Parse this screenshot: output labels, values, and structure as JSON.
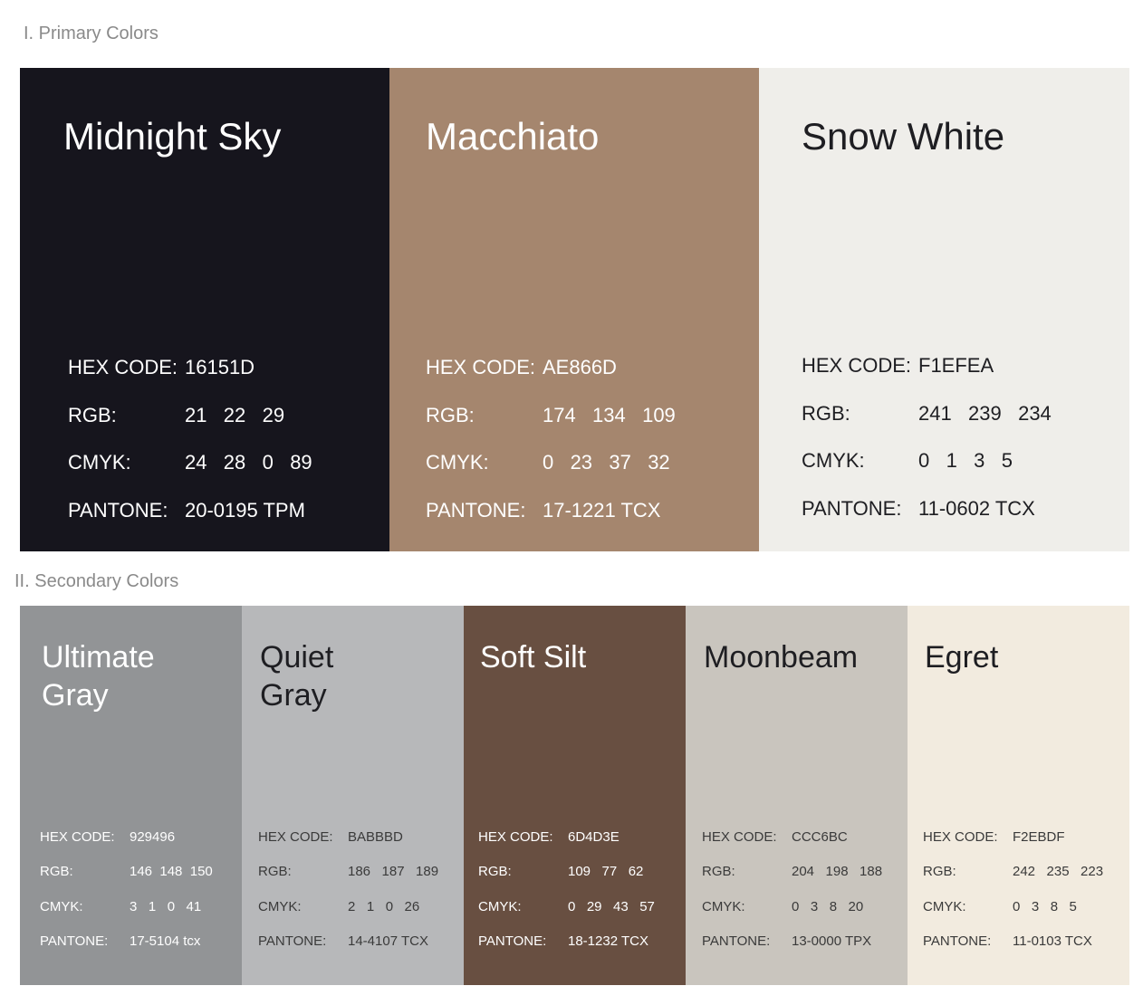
{
  "sections": {
    "primary_title": "I. Primary Colors",
    "secondary_title": "II. Secondary Colors"
  },
  "labels": {
    "hex": "HEX CODE:",
    "rgb": "RGB:",
    "cmyk": "CMYK:",
    "pantone": "PANTONE:"
  },
  "primary": [
    {
      "name": "Midnight Sky",
      "hex": "16151D",
      "rgb": "21   22   29",
      "cmyk": "24   28   0   89",
      "pantone": "20-0195 TPM",
      "color": "#16151D"
    },
    {
      "name": "Macchiato",
      "hex": "AE866D",
      "rgb": "174   134   109",
      "cmyk": "0   23   37   32",
      "pantone": "17-1221 TCX",
      "color": "#A5866E"
    },
    {
      "name": "Snow White",
      "hex": "F1EFEA",
      "rgb": "241   239   234",
      "cmyk": "0   1   3   5",
      "pantone": "11-0602 TCX",
      "color": "#EFEEEA"
    }
  ],
  "secondary": [
    {
      "name": "Ultimate Gray",
      "hex": "929496",
      "rgb": "146  148  150",
      "cmyk": "3   1   0   41",
      "pantone": "17-5104 tcx",
      "color": "#929496"
    },
    {
      "name": "Quiet Gray",
      "hex": "BABBBD",
      "rgb": "186   187   189",
      "cmyk": "2   1   0   26",
      "pantone": "14-4107 TCX",
      "color": "#B7B8BA"
    },
    {
      "name": "Soft Silt",
      "hex": "6D4D3E",
      "rgb": "109   77   62",
      "cmyk": "0   29   43   57",
      "pantone": "18-1232 TCX",
      "color": "#684F41"
    },
    {
      "name": "Moonbeam",
      "hex": "CCC6BC",
      "rgb": "204   198   188",
      "cmyk": "0   3   8   20",
      "pantone": "13-0000 TPX",
      "color": "#C9C5BE"
    },
    {
      "name": "Egret",
      "hex": "F2EBDF",
      "rgb": "242   235   223",
      "cmyk": "0   3   8   5",
      "pantone": "11-0103 TCX",
      "color": "#F2EBDF"
    }
  ]
}
